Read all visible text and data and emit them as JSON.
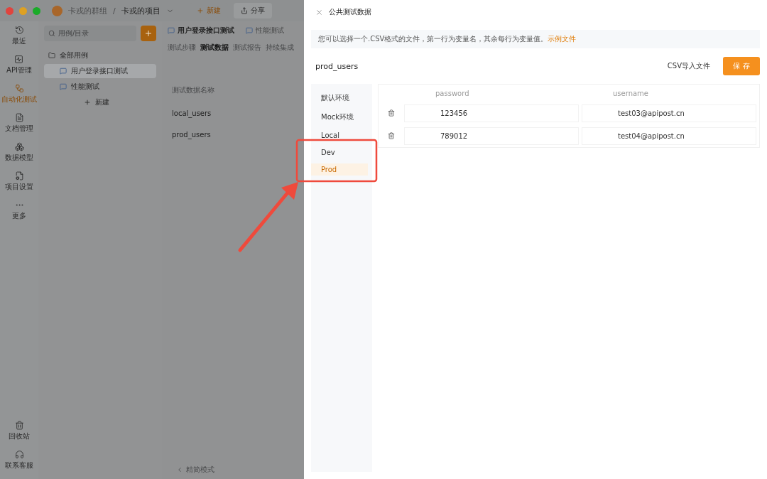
{
  "titlebar": {
    "group": "卡戎的群组",
    "separator": "/",
    "project": "卡戎的项目",
    "new_button": "新建",
    "share_button": "分享"
  },
  "nav": [
    {
      "label": "最近",
      "selected": false
    },
    {
      "label": "API管理",
      "selected": false
    },
    {
      "label": "自动化测试",
      "selected": true
    },
    {
      "label": "文档管理",
      "selected": false
    },
    {
      "label": "数据模型",
      "selected": false
    },
    {
      "label": "项目设置",
      "selected": false
    },
    {
      "label": "更多",
      "selected": false
    }
  ],
  "nav_bottom": [
    {
      "label": "回收站"
    },
    {
      "label": "联系客服"
    }
  ],
  "tree": {
    "search": {
      "placeholder": "用例/目录"
    },
    "root": "全部用例",
    "items": [
      {
        "label": "用户登录接口测试",
        "selected": true
      },
      {
        "label": "性能测试",
        "selected": false
      }
    ],
    "new_label": "新建"
  },
  "content": {
    "open_tabs": [
      {
        "label": "用户登录接口测试",
        "selected": true
      },
      {
        "label": "性能测试",
        "selected": false
      }
    ],
    "sub_tabs": [
      {
        "label": "测试步骤",
        "selected": false
      },
      {
        "label": "测试数据",
        "selected": true
      },
      {
        "label": "测试报告",
        "selected": false
      },
      {
        "label": "持续集成",
        "selected": false
      }
    ],
    "list_header": "测试数据名称",
    "list": [
      "local_users",
      "prod_users"
    ],
    "footer": "精简模式"
  },
  "drawer": {
    "title": "公共测试数据",
    "hint": "您可以选择一个.CSV格式的文件，第一行为变量名，其余每行为变量值。",
    "hint_link": "示例文件",
    "name": "prod_users",
    "import_button": "CSV导入文件",
    "save_button": "保存",
    "environments": [
      {
        "label": "默认环境",
        "selected": false
      },
      {
        "label": "Mock环境",
        "selected": false
      },
      {
        "label": "Local",
        "selected": false
      },
      {
        "label": "Dev",
        "selected": false
      },
      {
        "label": "Prod",
        "selected": true
      }
    ],
    "columns": [
      "password",
      "username"
    ],
    "rows": [
      [
        "123456",
        "test03@apipost.cn"
      ],
      [
        "789012",
        "test04@apipost.cn"
      ]
    ]
  }
}
